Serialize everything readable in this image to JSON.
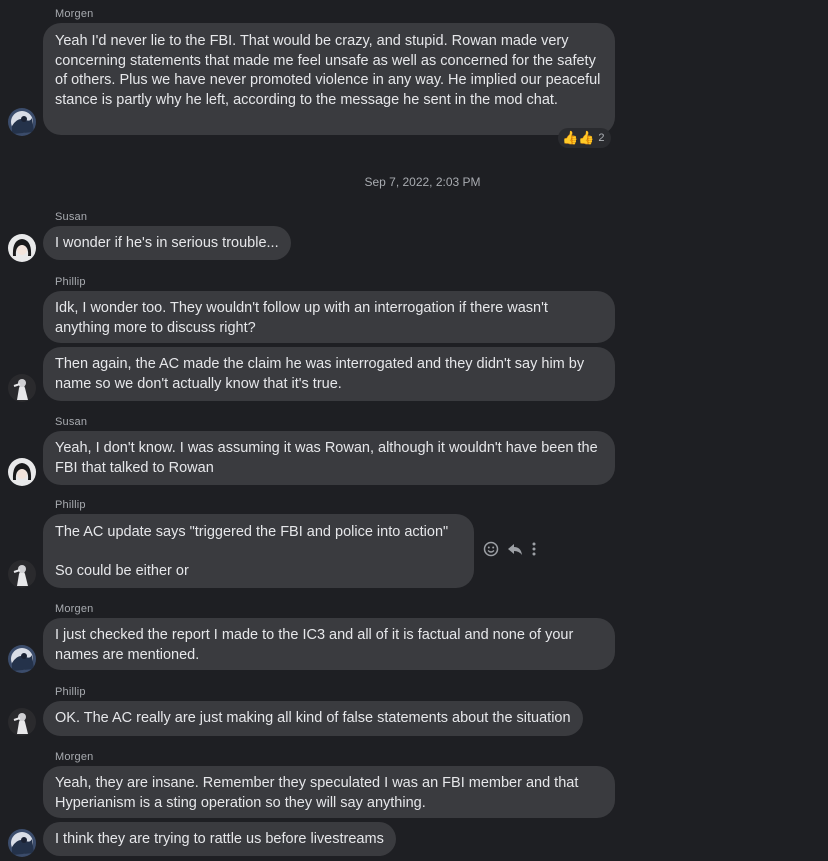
{
  "thread": {
    "timestamp_divider": "Sep 7, 2022, 2:03 PM",
    "messages": [
      {
        "sender": "Morgen",
        "text": "Yeah I'd never lie to the FBI. That would be crazy, and stupid. Rowan made very concerning statements that made me feel unsafe as well as concerned for the safety of others. Plus we have never promoted violence in any way. He implied our peaceful stance is partly why he left, according to the message he sent in the mod chat.",
        "reactions": {
          "emoji": "👍👍",
          "count": "2"
        }
      },
      {
        "sender": "Susan",
        "text": "I wonder if he's in serious trouble..."
      },
      {
        "sender": "Phillip",
        "text": "Idk, I wonder too. They wouldn't follow up with an interrogation if there wasn't anything more to discuss right?"
      },
      {
        "sender": "",
        "text": "Then again, the AC made the claim he was interrogated and they didn't say him by name so we don't actually know that it's true."
      },
      {
        "sender": "Susan",
        "text": "Yeah, I don't know. I was assuming it was Rowan, although it wouldn't have been the FBI that talked to Rowan"
      },
      {
        "sender": "Phillip",
        "text_line1": "The AC update says \"triggered the FBI and police into action\"",
        "text_line2": "So could be either or"
      },
      {
        "sender": "Morgen",
        "text": "I just checked the report I made to the IC3 and all of it is factual and none of your names are mentioned."
      },
      {
        "sender": "Phillip",
        "text": "OK. The AC really are just making all kind of false statements about the situation"
      },
      {
        "sender": "Morgen",
        "text": "Yeah, they are insane. Remember they speculated I was an FBI member and that Hyperianism is a sting operation so they will say anything."
      },
      {
        "sender": "",
        "text": "I think they are trying to rattle us before livestreams"
      }
    ]
  },
  "icons": {
    "hover_actions": [
      "emoji-react-icon",
      "reply-icon",
      "more-options-icon"
    ],
    "avatars": [
      "morgen-avatar",
      "susan-avatar",
      "phillip-avatar"
    ]
  },
  "colors": {
    "background": "#1e1f23",
    "bubble": "#3a3b3f",
    "text": "#e6e7ea",
    "meta": "#a8abb0"
  }
}
